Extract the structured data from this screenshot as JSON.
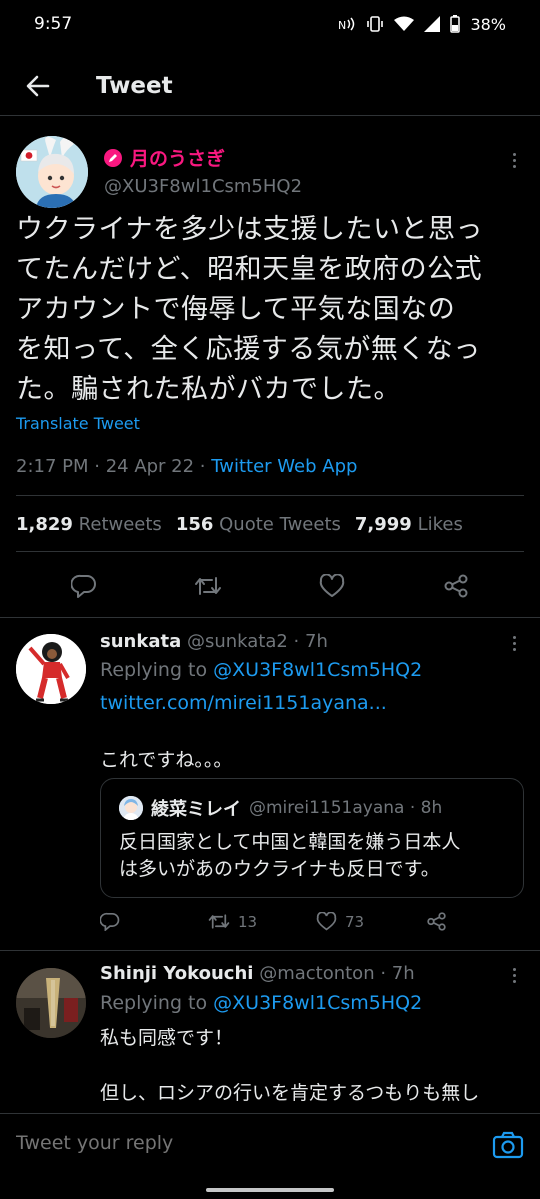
{
  "status_bar": {
    "time": "9:57",
    "battery": "38%"
  },
  "header": {
    "title": "Tweet"
  },
  "main_tweet": {
    "name": "月のうさぎ",
    "handle": "@XU3F8wl1Csm5HQ2",
    "text_lines": [
      "ウクライナを多少は支援したいと思っ",
      "てたんだけど、昭和天皇を政府の公式",
      "アカウントで侮辱して平気な国なの",
      "を知って、全く応援する気が無くなっ",
      "た。騙された私がバカでした。"
    ],
    "translate": "Translate Tweet",
    "meta": "2:17 PM · 24 Apr 22 · ",
    "source": "Twitter Web App",
    "stats": {
      "retweets": "1,829",
      "retweets_label": "Retweets",
      "quotes": "156",
      "quotes_label": "Quote Tweets",
      "likes": "7,999",
      "likes_label": "Likes"
    }
  },
  "reply1": {
    "name": "sunkata",
    "handle": "@sunkata2 · 7h",
    "replying_prefix": "Replying to ",
    "replying_handle": "@XU3F8wl1Csm5HQ2",
    "link": "twitter.com/mirei1151ayana...",
    "text": "これですね。。。",
    "quote": {
      "name": "綾菜ミレイ",
      "handle": "@mirei1151ayana · 8h",
      "text_lines": [
        "反日国家として中国と韓国を嫌う日本人",
        "は多いがあのウクライナも反日です。"
      ]
    },
    "retweets": "13",
    "likes": "73"
  },
  "reply2": {
    "name": "Shinji Yokouchi",
    "handle": "@mactonton · 7h",
    "replying_prefix": "Replying to ",
    "replying_handle": "@XU3F8wl1Csm5HQ2",
    "text_line1": "私も同感です！",
    "text_line2": "但し、ロシアの行いを肯定するつもりも無し"
  },
  "reply_bar": {
    "placeholder": "Tweet your reply"
  }
}
